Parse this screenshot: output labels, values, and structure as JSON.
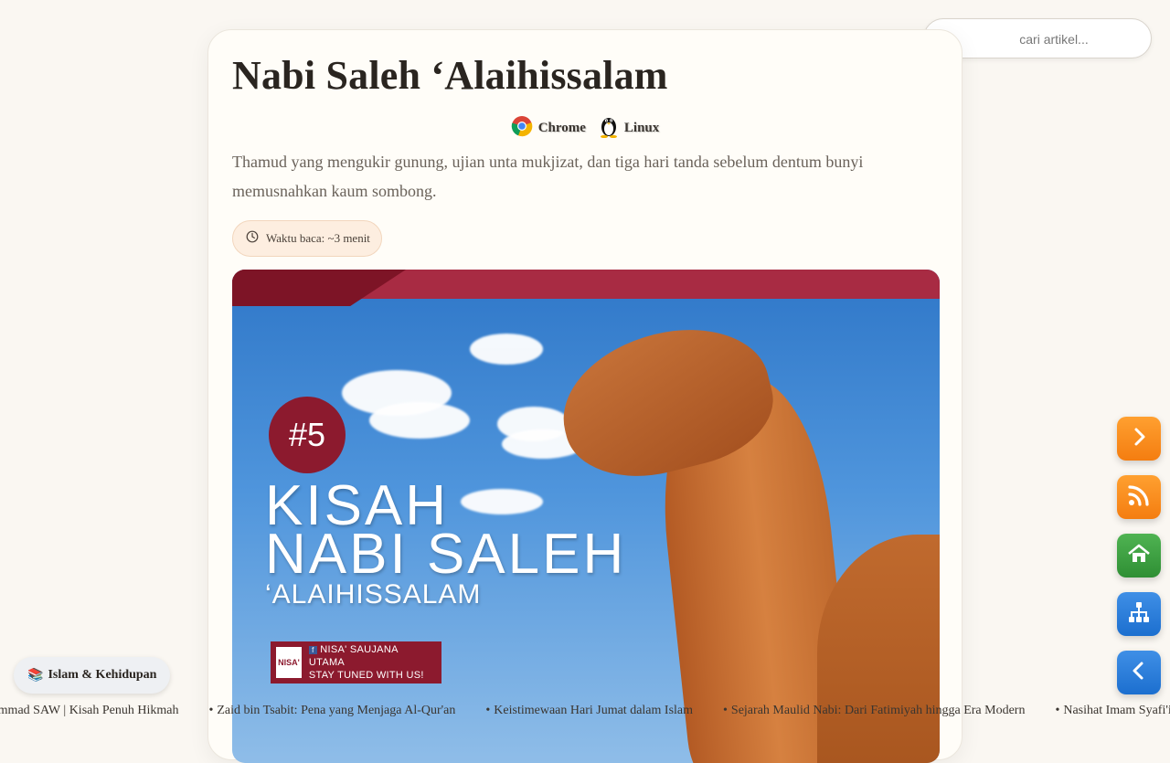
{
  "article": {
    "title": "Nabi Saleh ‘Alaihissalam",
    "platforms": [
      {
        "label": "Chrome",
        "icon": "chrome-icon"
      },
      {
        "label": "Linux",
        "icon": "linux-tux-icon"
      }
    ],
    "excerpt": "Thamud yang mengukir gunung, ujian unta mukjizat, dan tiga hari tanda sebelum dentum bunyi memusnahkan kaum sombong.",
    "reading_time": "Waktu baca: ~3 menit"
  },
  "hero": {
    "badge": "#5",
    "line1": "KISAH",
    "line2": "NABI SALEH",
    "line3": "‘ALAIHISSALAM",
    "logo_mark": "NISA'",
    "logo_line1": "NISA' SAUJANA UTAMA",
    "logo_line2": "STAY TUNED WITH US!"
  },
  "search": {
    "placeholder": "cari artikel..."
  },
  "category": {
    "icon": "📚",
    "label": "Islam & Kehidupan"
  },
  "ticker": [
    "Muhammad SAW | Kisah Penuh Hikmah",
    "Zaid bin Tsabit: Pena yang Menjaga Al-Qur'an",
    "Keistimewaan Hari Jumat dalam Islam",
    "Sejarah Maulid Nabi: Dari Fatimiyah hingga Era Modern",
    "Nasihat Imam Syafi'i: J"
  ],
  "colors": {
    "accent_orange": "#f47d10",
    "accent_green": "#2f8f34",
    "accent_blue": "#1c6fcf",
    "hero_maroon": "#8c1a2e"
  }
}
